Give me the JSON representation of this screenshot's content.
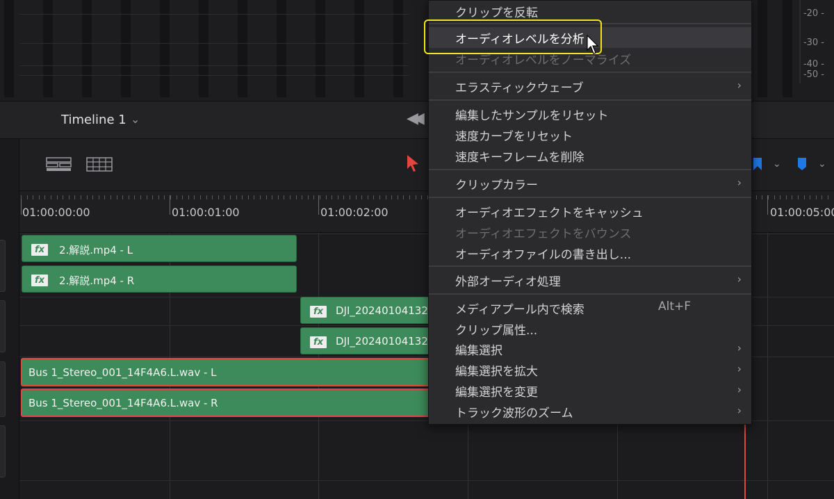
{
  "meters": {
    "db_labels": [
      "-20 -",
      "-30 -",
      "-40 -",
      "-50 -"
    ]
  },
  "timeline": {
    "name": "Timeline 1",
    "timecodes": [
      "01:00:00:00",
      "01:00:01:00",
      "01:00:02:00",
      "01:00:05:00"
    ]
  },
  "clips": [
    {
      "name": "2.解説.mp4 - L",
      "fx": "fx"
    },
    {
      "name": "2.解説.mp4 - R",
      "fx": "fx"
    },
    {
      "name": "DJI_20240104132",
      "fx": "fx"
    },
    {
      "name": "DJI_20240104132",
      "fx": "fx"
    },
    {
      "name": "Bus 1_Stereo_001_14F4A6.L.wav - L"
    },
    {
      "name": "Bus 1_Stereo_001_14F4A6.L.wav - R"
    }
  ],
  "menu": {
    "items": [
      {
        "label": "クリップを反転"
      },
      {
        "label": "オーディオレベルを分析"
      },
      {
        "label": "オーディオレベルをノーマライズ"
      },
      {
        "label": "エラスティックウェーブ",
        "arrow": "›"
      },
      {
        "label": "編集したサンプルをリセット"
      },
      {
        "label": "速度カーブをリセット"
      },
      {
        "label": "速度キーフレームを削除"
      },
      {
        "label": "クリップカラー",
        "arrow": "›"
      },
      {
        "label": "オーディオエフェクトをキャッシュ"
      },
      {
        "label": "オーディオエフェクトをバウンス"
      },
      {
        "label": "オーディオファイルの書き出し..."
      },
      {
        "label": "外部オーディオ処理",
        "arrow": "›"
      },
      {
        "label": "メディアプール内で検索",
        "shortcut": "Alt+F"
      },
      {
        "label": "クリップ属性..."
      },
      {
        "label": "編集選択",
        "arrow": "›"
      },
      {
        "label": "編集選択を拡大",
        "arrow": "›"
      },
      {
        "label": "編集選択を変更",
        "arrow": "›"
      },
      {
        "label": "トラック波形のズーム",
        "arrow": "›"
      }
    ]
  },
  "colors": {
    "clip_green": "#3d8a5a",
    "selection_red": "#e4463c",
    "highlight_yellow": "#f0e61e",
    "marker_blue": "#1e78e6"
  },
  "icons": {
    "chevron": "⌄",
    "rewind": "◀◀"
  }
}
